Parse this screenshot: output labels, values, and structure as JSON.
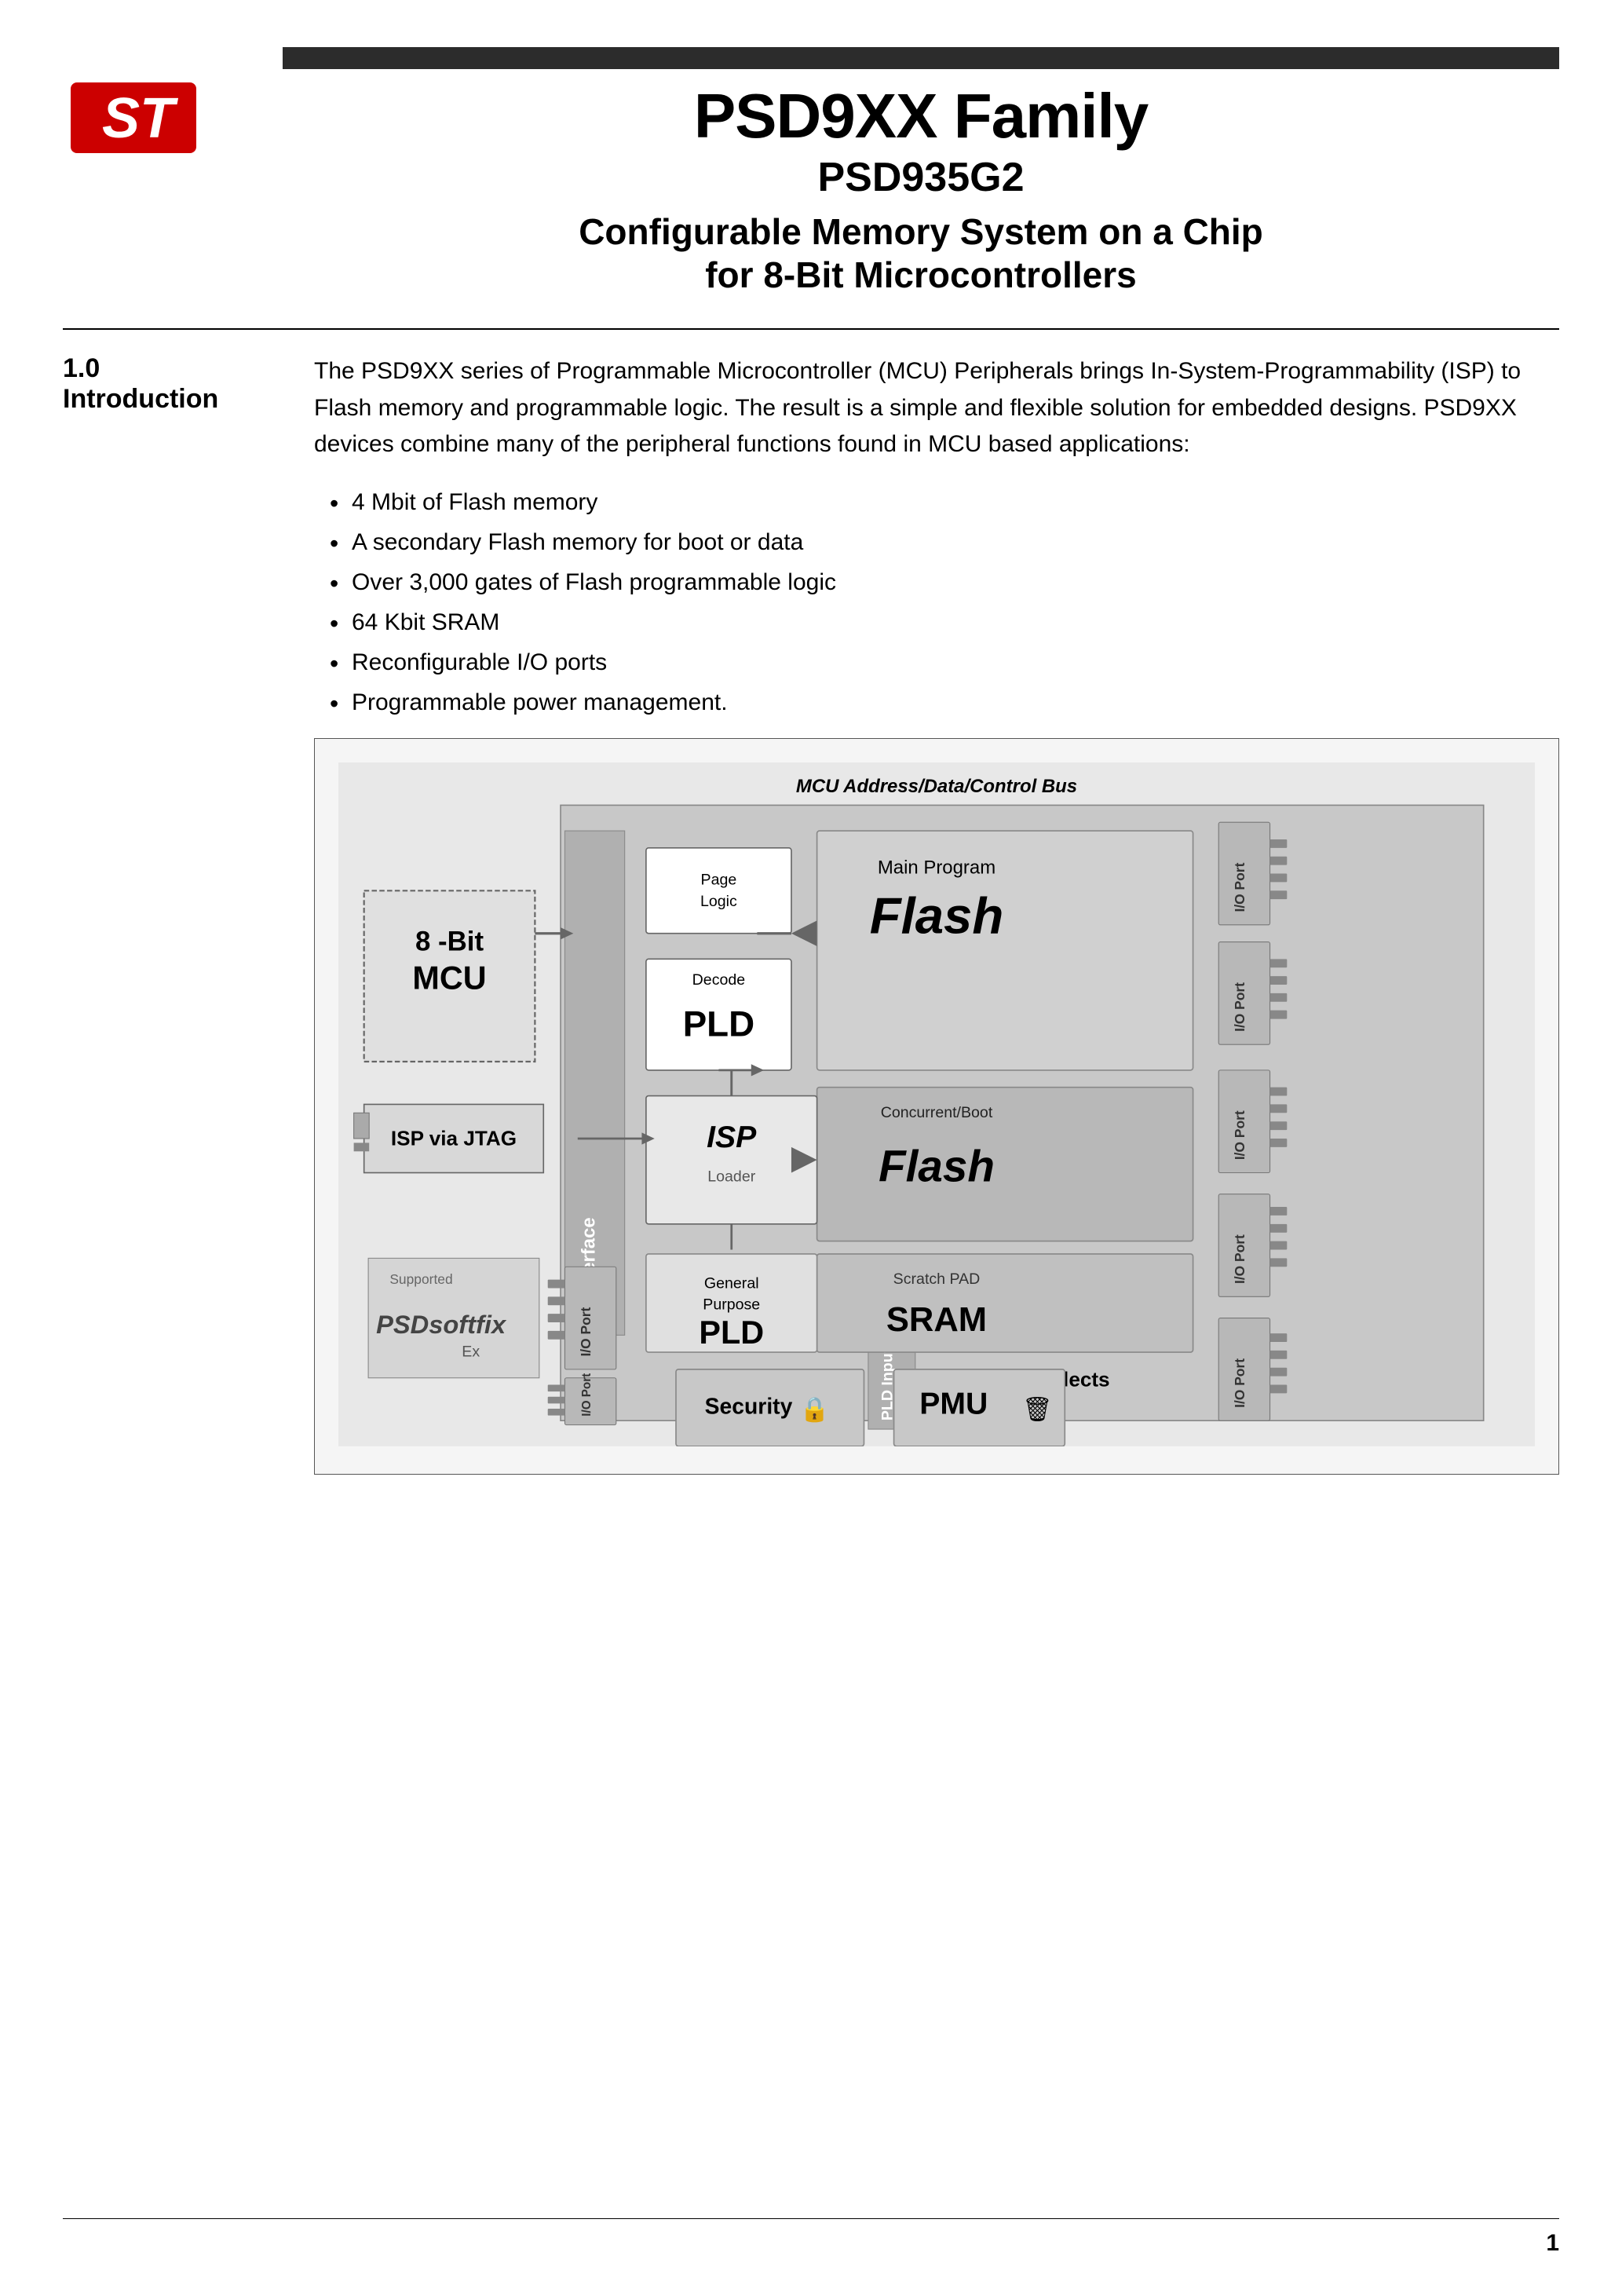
{
  "header": {
    "bar_color": "#2c2c2c",
    "family": "PSD9XX Family",
    "model": "PSD935G2",
    "description": "Configurable Memory System on a Chip\nfor 8-Bit Microcontrollers"
  },
  "section": {
    "number": "1.0",
    "title": "Introduction",
    "paragraph": "The PSD9XX series of Programmable Microcontroller (MCU) Peripherals brings In-System-Programmability (ISP) to Flash memory and programmable logic. The result is a simple and flexible solution for embedded designs. PSD9XX devices combine many of the peripheral functions found in MCU based applications:",
    "bullets": [
      "4 Mbit of Flash memory",
      "A secondary Flash memory for boot or data",
      "Over 3,000 gates of Flash programmable logic",
      "64 Kbit SRAM",
      "Reconfigurable I/O ports",
      "Programmable power management."
    ]
  },
  "diagram": {
    "title": "MCU Address/Data/Control Bus",
    "blocks": {
      "mcu": "8 -Bit\nMCU",
      "mcu_interface": "MCU Interface",
      "page_logic": "Page\nLogic",
      "main_program": "Main Program",
      "main_flash": "Flash",
      "decode": "Decode",
      "pld_decode": "PLD",
      "concurrent_boot": "Concurrent/Boot",
      "boot_flash": "Flash",
      "isp_via_jtag": "ISP via JTAG",
      "isp": "ISP",
      "loader": "Loader",
      "scratch_pad": "Scratch PAD",
      "sram": "SRAM",
      "general_purpose": "General\nPurpose",
      "gp_pld": "PLD",
      "external_chip_selects": "External Chip Selects",
      "pld_input_bus": "PLD Input Bus",
      "security": "Security",
      "pmu": "PMU",
      "io_port": "I/O Port",
      "supported_by": "Supported"
    }
  },
  "footer": {
    "left_text": "",
    "page_number": "1"
  }
}
